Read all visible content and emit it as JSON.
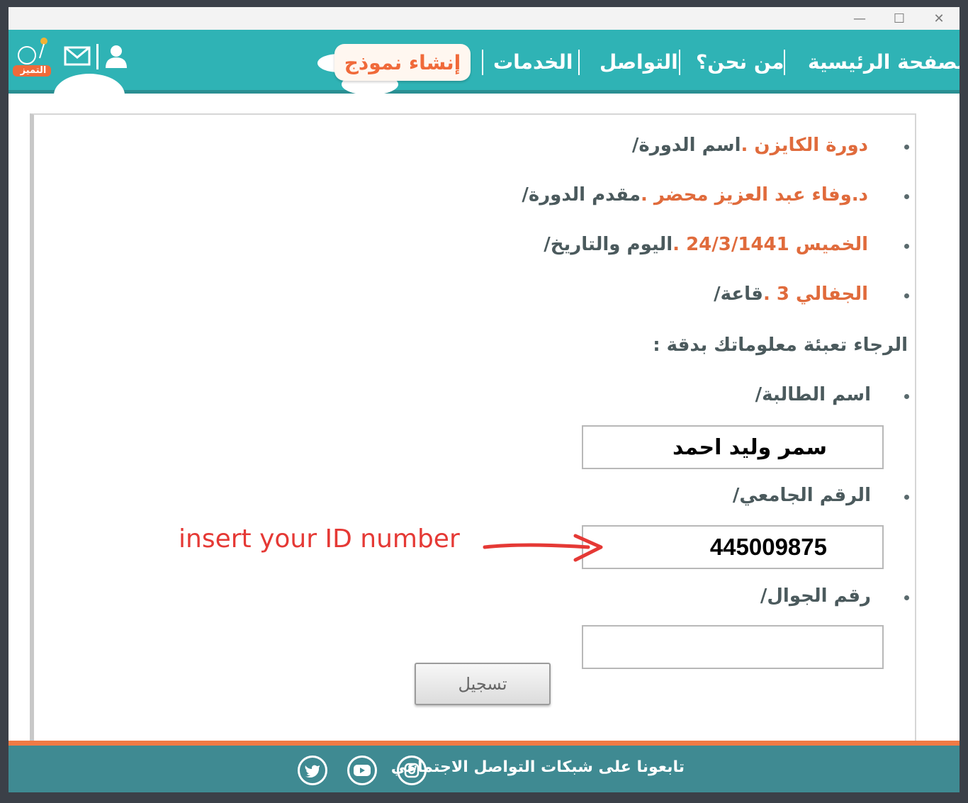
{
  "window_controls": {
    "minimize": "—",
    "maximize": "☐",
    "close": "✕"
  },
  "nav": {
    "home": "الصفحة الرئيسية",
    "about": "من نحن؟",
    "contact": "التواصل",
    "services": "الخدمات",
    "create_form": "إنشاء نموذج",
    "logo_text": "التميز"
  },
  "course": {
    "name_label": "اسم الدورة/",
    "name_value": "دورة الكايزن .",
    "presenter_label": "مقدم الدورة/",
    "presenter_value": "د.وفاء عبد العزيز محضر .",
    "date_label": "اليوم والتاريخ/",
    "date_value": "الخميس 24/3/1441 .",
    "hall_label": "قاعة/",
    "hall_value": "الجفالي 3 ."
  },
  "form": {
    "instruction": "الرجاء تعبئة معلوماتك بدقة :",
    "student_name_label": "اسم الطالبة/",
    "student_name_value": "سمر وليد احمد",
    "university_id_label": "الرقم الجامعي/",
    "university_id_value": "445009875",
    "mobile_label": "رقم الجوال/",
    "mobile_value": "",
    "submit_label": "تسجيل"
  },
  "annotation": {
    "text": "insert your ID number",
    "color": "#e53935"
  },
  "footer": {
    "text": "تابعونا على شبكات التواصل الاجتماعي"
  },
  "colors": {
    "header": "#2fb3b5",
    "footer": "#3f8a92",
    "accent": "#ef7a45",
    "value_text": "#e06b3c"
  }
}
